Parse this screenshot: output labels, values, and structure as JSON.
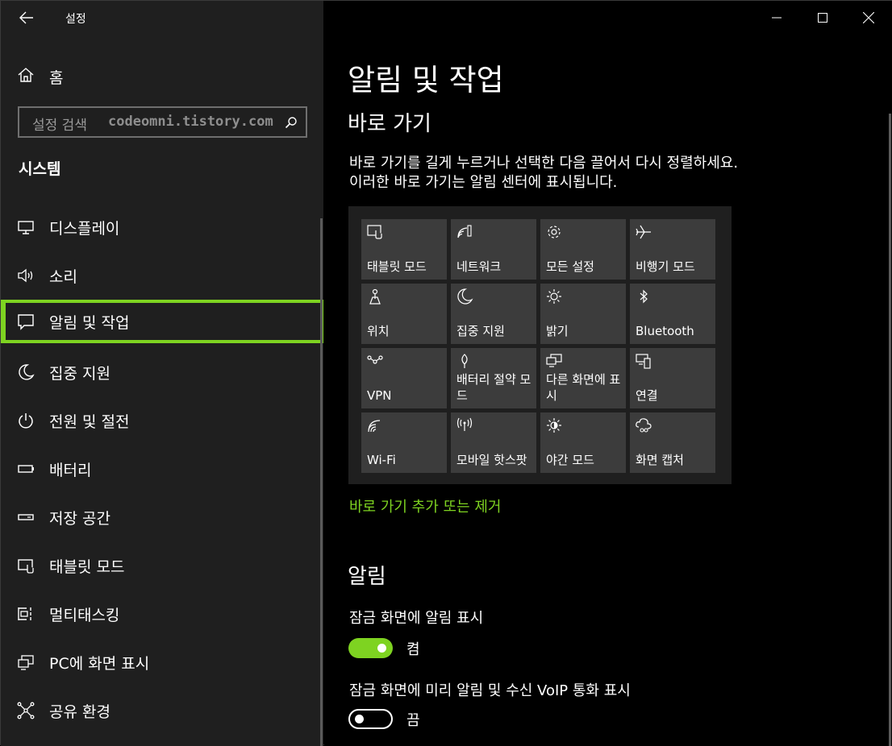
{
  "window": {
    "title": "설정"
  },
  "sidebar": {
    "home_label": "홈",
    "search_placeholder": "설정 검색",
    "watermark": "codeomni.tistory.com",
    "section_title": "시스템",
    "items": [
      {
        "label": "디스플레이",
        "icon": "monitor-icon"
      },
      {
        "label": "소리",
        "icon": "speaker-icon"
      },
      {
        "label": "알림 및 작업",
        "icon": "message-icon",
        "selected": true
      },
      {
        "label": "집중 지원",
        "icon": "moon-icon"
      },
      {
        "label": "전원 및 절전",
        "icon": "power-icon"
      },
      {
        "label": "배터리",
        "icon": "battery-icon"
      },
      {
        "label": "저장 공간",
        "icon": "drive-icon"
      },
      {
        "label": "태블릿 모드",
        "icon": "tablet-icon"
      },
      {
        "label": "멀티태스킹",
        "icon": "multitask-icon"
      },
      {
        "label": "PC에 화면 표시",
        "icon": "project-icon"
      },
      {
        "label": "공유 환경",
        "icon": "share-icon"
      }
    ]
  },
  "main": {
    "title": "알림 및 작업",
    "quick_actions": {
      "heading": "바로 가기",
      "description_line1": "바로 가기를 길게 누르거나 선택한 다음 끌어서 다시 정렬하세요.",
      "description_line2": "이러한 바로 가기는 알림 센터에 표시됩니다.",
      "tiles": [
        {
          "label": "태블릿 모드",
          "icon": "tablet-mode-icon"
        },
        {
          "label": "네트워크",
          "icon": "network-icon"
        },
        {
          "label": "모든 설정",
          "icon": "gear-icon"
        },
        {
          "label": "비행기 모드",
          "icon": "airplane-icon"
        },
        {
          "label": "위치",
          "icon": "location-icon"
        },
        {
          "label": "집중 지원",
          "icon": "moon-icon"
        },
        {
          "label": "밝기",
          "icon": "brightness-icon"
        },
        {
          "label": "Bluetooth",
          "icon": "bluetooth-icon"
        },
        {
          "label": "VPN",
          "icon": "vpn-icon"
        },
        {
          "label": "배터리 절약 모드",
          "icon": "battery-saver-icon"
        },
        {
          "label": "다른 화면에 표시",
          "icon": "project-icon"
        },
        {
          "label": "연결",
          "icon": "connect-icon"
        },
        {
          "label": "Wi-Fi",
          "icon": "wifi-icon"
        },
        {
          "label": "모바일 핫스팟",
          "icon": "hotspot-icon"
        },
        {
          "label": "야간 모드",
          "icon": "night-light-icon"
        },
        {
          "label": "화면 캡처",
          "icon": "screen-snip-icon"
        }
      ],
      "edit_link": "바로 가기 추가 또는 제거"
    },
    "notifications": {
      "heading": "알림",
      "options": [
        {
          "label": "잠금 화면에 알림 표시",
          "state": "켬",
          "on": true
        },
        {
          "label": "잠금 화면에 미리 알림 및 수신 VoIP 통화 표시",
          "state": "끔",
          "on": false
        }
      ]
    }
  },
  "colors": {
    "accent": "#7ed321",
    "sidebar_bg": "#1f1f1f",
    "main_bg": "#000000",
    "tile_bg": "#3c3c3c"
  }
}
